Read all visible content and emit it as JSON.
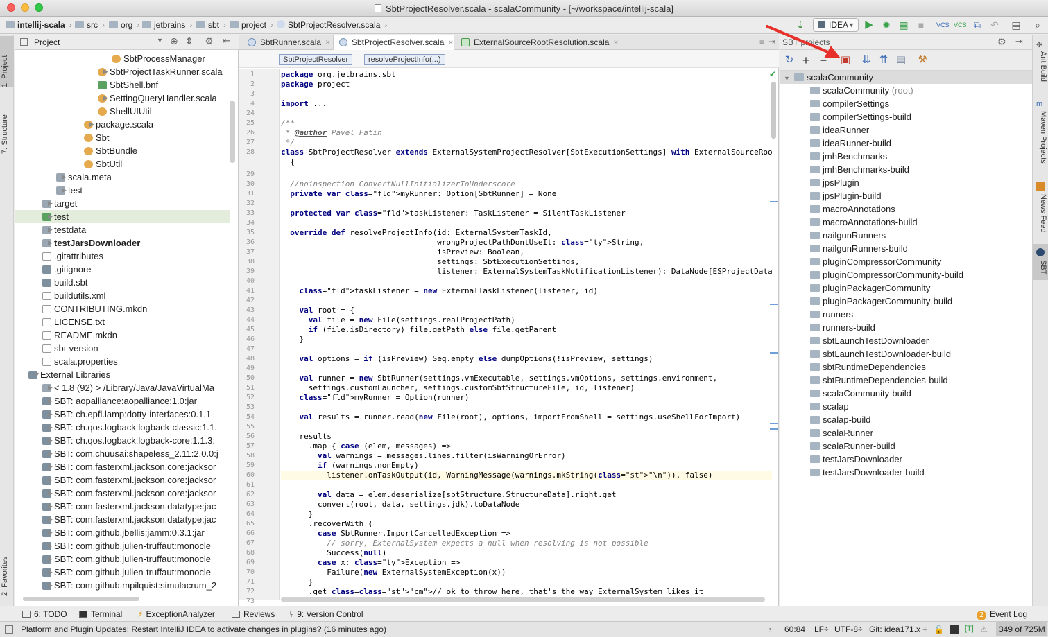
{
  "window": {
    "title": "SbtProjectResolver.scala - scalaCommunity - [~/workspace/intellij-scala]"
  },
  "breadcrumbs": [
    "intellij-scala",
    "src",
    "org",
    "jetbrains",
    "sbt",
    "project",
    "SbtProjectResolver.scala"
  ],
  "run_config": "IDEA",
  "left_strip": {
    "project": "1: Project",
    "structure": "7: Structure",
    "favorites": "2: Favorites"
  },
  "project_panel": {
    "title": "Project",
    "tree": [
      {
        "label": "SbtProcessManager",
        "indent": 145,
        "icon": "scala-class-icon",
        "arrow": false,
        "bold": false
      },
      {
        "label": "SbtProjectTaskRunner.scala",
        "indent": 125,
        "icon": "scala-file-icon",
        "arrow": true,
        "bold": false
      },
      {
        "label": "SbtShell.bnf",
        "indent": 125,
        "icon": "bnf-file-icon",
        "arrow": false,
        "bold": false
      },
      {
        "label": "SettingQueryHandler.scala",
        "indent": 125,
        "icon": "scala-file-icon",
        "arrow": true,
        "bold": false
      },
      {
        "label": "ShellUIUtil",
        "indent": 125,
        "icon": "scala-class-icon",
        "arrow": false,
        "bold": false
      },
      {
        "label": "package.scala",
        "indent": 105,
        "icon": "scala-package-icon",
        "arrow": true,
        "bold": false
      },
      {
        "label": "Sbt",
        "indent": 105,
        "icon": "scala-class-icon",
        "arrow": false,
        "bold": false
      },
      {
        "label": "SbtBundle",
        "indent": 105,
        "icon": "scala-class-icon",
        "arrow": false,
        "bold": false
      },
      {
        "label": "SbtUtil",
        "indent": 105,
        "icon": "scala-class-icon",
        "arrow": false,
        "bold": false
      },
      {
        "label": "scala.meta",
        "indent": 65,
        "icon": "folder-icon",
        "arrow": true,
        "bold": false
      },
      {
        "label": "test",
        "indent": 65,
        "icon": "folder-icon",
        "arrow": true,
        "bold": false
      },
      {
        "label": "target",
        "indent": 45,
        "icon": "folder-icon",
        "arrow": true,
        "bold": false
      },
      {
        "label": "test",
        "indent": 45,
        "icon": "test-folder-icon",
        "arrow": true,
        "bold": false
      },
      {
        "label": "testdata",
        "indent": 45,
        "icon": "folder-icon",
        "arrow": true,
        "bold": false
      },
      {
        "label": "testJarsDownloader",
        "indent": 45,
        "icon": "module-folder-icon",
        "arrow": true,
        "bold": true
      },
      {
        "label": ".gitattributes",
        "indent": 45,
        "icon": "text-file-icon",
        "arrow": false,
        "bold": false
      },
      {
        "label": ".gitignore",
        "indent": 45,
        "icon": "git-file-icon",
        "arrow": false,
        "bold": false
      },
      {
        "label": "build.sbt",
        "indent": 45,
        "icon": "sbt-file-icon",
        "arrow": false,
        "bold": false
      },
      {
        "label": "buildutils.xml",
        "indent": 45,
        "icon": "xml-file-icon",
        "arrow": false,
        "bold": false
      },
      {
        "label": "CONTRIBUTING.mkdn",
        "indent": 45,
        "icon": "text-file-icon",
        "arrow": false,
        "bold": false
      },
      {
        "label": "LICENSE.txt",
        "indent": 45,
        "icon": "text-file-icon",
        "arrow": false,
        "bold": false
      },
      {
        "label": "README.mkdn",
        "indent": 45,
        "icon": "text-file-icon",
        "arrow": false,
        "bold": false
      },
      {
        "label": "sbt-version",
        "indent": 45,
        "icon": "text-file-icon",
        "arrow": false,
        "bold": false
      },
      {
        "label": "scala.properties",
        "indent": 45,
        "icon": "properties-file-icon",
        "arrow": false,
        "bold": false
      },
      {
        "label": "External Libraries",
        "indent": 25,
        "icon": "library-icon",
        "arrow": true,
        "bold": false
      },
      {
        "label": "< 1.8 (92) >  /Library/Java/JavaVirtualMa",
        "indent": 45,
        "icon": "jdk-icon",
        "arrow": true,
        "bold": false
      },
      {
        "label": "SBT: aopalliance:aopalliance:1.0:jar",
        "indent": 45,
        "icon": "jar-library-icon",
        "arrow": true,
        "bold": false
      },
      {
        "label": "SBT: ch.epfl.lamp:dotty-interfaces:0.1.1-",
        "indent": 45,
        "icon": "jar-library-icon",
        "arrow": true,
        "bold": false
      },
      {
        "label": "SBT: ch.qos.logback:logback-classic:1.1.",
        "indent": 45,
        "icon": "jar-library-icon",
        "arrow": true,
        "bold": false
      },
      {
        "label": "SBT: ch.qos.logback:logback-core:1.1.3:",
        "indent": 45,
        "icon": "jar-library-icon",
        "arrow": true,
        "bold": false
      },
      {
        "label": "SBT: com.chuusai:shapeless_2.11:2.0.0:j",
        "indent": 45,
        "icon": "jar-library-icon",
        "arrow": true,
        "bold": false
      },
      {
        "label": "SBT: com.fasterxml.jackson.core:jacksor",
        "indent": 45,
        "icon": "jar-library-icon",
        "arrow": true,
        "bold": false
      },
      {
        "label": "SBT: com.fasterxml.jackson.core:jacksor",
        "indent": 45,
        "icon": "jar-library-icon",
        "arrow": true,
        "bold": false
      },
      {
        "label": "SBT: com.fasterxml.jackson.core:jacksor",
        "indent": 45,
        "icon": "jar-library-icon",
        "arrow": true,
        "bold": false
      },
      {
        "label": "SBT: com.fasterxml.jackson.datatype:jac",
        "indent": 45,
        "icon": "jar-library-icon",
        "arrow": true,
        "bold": false
      },
      {
        "label": "SBT: com.fasterxml.jackson.datatype:jac",
        "indent": 45,
        "icon": "jar-library-icon",
        "arrow": true,
        "bold": false
      },
      {
        "label": "SBT: com.github.jbellis:jamm:0.3.1:jar",
        "indent": 45,
        "icon": "jar-library-icon",
        "arrow": true,
        "bold": false
      },
      {
        "label": "SBT: com.github.julien-truffaut:monocle",
        "indent": 45,
        "icon": "jar-library-icon",
        "arrow": true,
        "bold": false
      },
      {
        "label": "SBT: com.github.julien-truffaut:monocle",
        "indent": 45,
        "icon": "jar-library-icon",
        "arrow": true,
        "bold": false
      },
      {
        "label": "SBT: com.github.julien-truffaut:monocle",
        "indent": 45,
        "icon": "jar-library-icon",
        "arrow": true,
        "bold": false
      },
      {
        "label": "SBT: com.github.mpilquist:simulacrum_2",
        "indent": 45,
        "icon": "jar-library-icon",
        "arrow": true,
        "bold": false
      }
    ]
  },
  "editor": {
    "tabs": [
      {
        "label": "SbtRunner.scala",
        "active": false
      },
      {
        "label": "SbtProjectResolver.scala",
        "active": true
      },
      {
        "label": "ExternalSourceRootResolution.scala",
        "active": false
      }
    ],
    "structure_crumbs": [
      "SbtProjectResolver",
      "resolveProjectInfo(...)"
    ],
    "lines": [
      {
        "n": "1",
        "text": "package org.jetbrains.sbt"
      },
      {
        "n": "2",
        "text": "package project"
      },
      {
        "n": "3",
        "text": ""
      },
      {
        "n": "4",
        "text": "import ..."
      },
      {
        "n": "24",
        "text": ""
      },
      {
        "n": "25",
        "text": "/**"
      },
      {
        "n": "26",
        "text": " * @author Pavel Fatin"
      },
      {
        "n": "27",
        "text": " */"
      },
      {
        "n": "28",
        "text": "class SbtProjectResolver extends ExternalSystemProjectResolver[SbtExecutionSettings] with ExternalSourceRootResolution"
      },
      {
        "n": "",
        "text": "  {"
      },
      {
        "n": "29",
        "text": ""
      },
      {
        "n": "30",
        "text": "  //noinspection ConvertNullInitializerToUnderscore"
      },
      {
        "n": "31",
        "text": "  private var myRunner: Option[SbtRunner] = None"
      },
      {
        "n": "32",
        "text": ""
      },
      {
        "n": "33",
        "text": "  protected var taskListener: TaskListener = SilentTaskListener"
      },
      {
        "n": "34",
        "text": ""
      },
      {
        "n": "35",
        "text": "  override def resolveProjectInfo(id: ExternalSystemTaskId,"
      },
      {
        "n": "36",
        "text": "                                  wrongProjectPathDontUseIt: String,"
      },
      {
        "n": "37",
        "text": "                                  isPreview: Boolean,"
      },
      {
        "n": "38",
        "text": "                                  settings: SbtExecutionSettings,"
      },
      {
        "n": "39",
        "text": "                                  listener: ExternalSystemTaskNotificationListener): DataNode[ESProjectData] = {"
      },
      {
        "n": "40",
        "text": ""
      },
      {
        "n": "41",
        "text": "    taskListener = new ExternalTaskListener(listener, id)"
      },
      {
        "n": "42",
        "text": ""
      },
      {
        "n": "43",
        "text": "    val root = {"
      },
      {
        "n": "44",
        "text": "      val file = new File(settings.realProjectPath)"
      },
      {
        "n": "45",
        "text": "      if (file.isDirectory) file.getPath else file.getParent"
      },
      {
        "n": "46",
        "text": "    }"
      },
      {
        "n": "47",
        "text": ""
      },
      {
        "n": "48",
        "text": "    val options = if (isPreview) Seq.empty else dumpOptions(!isPreview, settings)"
      },
      {
        "n": "49",
        "text": ""
      },
      {
        "n": "50",
        "text": "    val runner = new SbtRunner(settings.vmExecutable, settings.vmOptions, settings.environment,"
      },
      {
        "n": "51",
        "text": "      settings.customLauncher, settings.customSbtStructureFile, id, listener)"
      },
      {
        "n": "52",
        "text": "    myRunner = Option(runner)"
      },
      {
        "n": "53",
        "text": ""
      },
      {
        "n": "54",
        "text": "    val results = runner.read(new File(root), options, importFromShell = settings.useShellForImport)"
      },
      {
        "n": "55",
        "text": ""
      },
      {
        "n": "56",
        "text": "    results"
      },
      {
        "n": "57",
        "text": "      .map { case (elem, messages) =>"
      },
      {
        "n": "58",
        "text": "        val warnings = messages.lines.filter(isWarningOrError)"
      },
      {
        "n": "59",
        "text": "        if (warnings.nonEmpty)"
      },
      {
        "n": "60",
        "text": "          listener.onTaskOutput(id, WarningMessage(warnings.mkString(\"\\n\")), false)"
      },
      {
        "n": "61",
        "text": ""
      },
      {
        "n": "62",
        "text": "        val data = elem.deserialize[sbtStructure.StructureData].right.get"
      },
      {
        "n": "63",
        "text": "        convert(root, data, settings.jdk).toDataNode"
      },
      {
        "n": "64",
        "text": "      }"
      },
      {
        "n": "65",
        "text": "      .recoverWith {"
      },
      {
        "n": "66",
        "text": "        case SbtRunner.ImportCancelledException =>"
      },
      {
        "n": "67",
        "text": "          // sorry, ExternalSystem expects a null when resolving is not possible"
      },
      {
        "n": "68",
        "text": "          Success(null)"
      },
      {
        "n": "69",
        "text": "        case x: Exception =>"
      },
      {
        "n": "70",
        "text": "          Failure(new ExternalSystemException(x))"
      },
      {
        "n": "71",
        "text": "      }"
      },
      {
        "n": "72",
        "text": "      .get // ok to throw here, that's the way ExternalSystem likes it"
      },
      {
        "n": "73",
        "text": ""
      }
    ]
  },
  "sbt_panel": {
    "title": "SBT projects",
    "root": "scalaCommunity",
    "items": [
      {
        "label": "scalaCommunity",
        "suffix": " (root)"
      },
      {
        "label": "compilerSettings",
        "suffix": ""
      },
      {
        "label": "compilerSettings-build",
        "suffix": ""
      },
      {
        "label": "ideaRunner",
        "suffix": ""
      },
      {
        "label": "ideaRunner-build",
        "suffix": ""
      },
      {
        "label": "jmhBenchmarks",
        "suffix": ""
      },
      {
        "label": "jmhBenchmarks-build",
        "suffix": ""
      },
      {
        "label": "jpsPlugin",
        "suffix": ""
      },
      {
        "label": "jpsPlugin-build",
        "suffix": ""
      },
      {
        "label": "macroAnnotations",
        "suffix": ""
      },
      {
        "label": "macroAnnotations-build",
        "suffix": ""
      },
      {
        "label": "nailgunRunners",
        "suffix": ""
      },
      {
        "label": "nailgunRunners-build",
        "suffix": ""
      },
      {
        "label": "pluginCompressorCommunity",
        "suffix": ""
      },
      {
        "label": "pluginCompressorCommunity-build",
        "suffix": ""
      },
      {
        "label": "pluginPackagerCommunity",
        "suffix": ""
      },
      {
        "label": "pluginPackagerCommunity-build",
        "suffix": ""
      },
      {
        "label": "runners",
        "suffix": ""
      },
      {
        "label": "runners-build",
        "suffix": ""
      },
      {
        "label": "sbtLaunchTestDownloader",
        "suffix": ""
      },
      {
        "label": "sbtLaunchTestDownloader-build",
        "suffix": ""
      },
      {
        "label": "sbtRuntimeDependencies",
        "suffix": ""
      },
      {
        "label": "sbtRuntimeDependencies-build",
        "suffix": ""
      },
      {
        "label": "scalaCommunity-build",
        "suffix": ""
      },
      {
        "label": "scalap",
        "suffix": ""
      },
      {
        "label": "scalap-build",
        "suffix": ""
      },
      {
        "label": "scalaRunner",
        "suffix": ""
      },
      {
        "label": "scalaRunner-build",
        "suffix": ""
      },
      {
        "label": "testJarsDownloader",
        "suffix": ""
      },
      {
        "label": "testJarsDownloader-build",
        "suffix": ""
      }
    ]
  },
  "right_strip": {
    "ant": "Ant Build",
    "maven": "Maven Projects",
    "news": "News Feed",
    "sbt": "SBT"
  },
  "bottom_tabs": {
    "todo": "6: TODO",
    "terminal": "Terminal",
    "exception": "ExceptionAnalyzer",
    "reviews": "Reviews",
    "vcs": "9: Version Control",
    "eventlog": "Event Log",
    "eventcount": "2"
  },
  "status": {
    "message": "Platform and Plugin Updates: Restart IntelliJ IDEA to activate changes in plugins? (16 minutes ago)",
    "position": "60:84",
    "line_sep": "LF÷",
    "encoding": "UTF-8÷",
    "git": "Git: idea171.x ÷",
    "memory": "349 of 725M"
  },
  "colors": {
    "annotation_arrow": "#e8302a",
    "accent": "#3b6cb7"
  }
}
